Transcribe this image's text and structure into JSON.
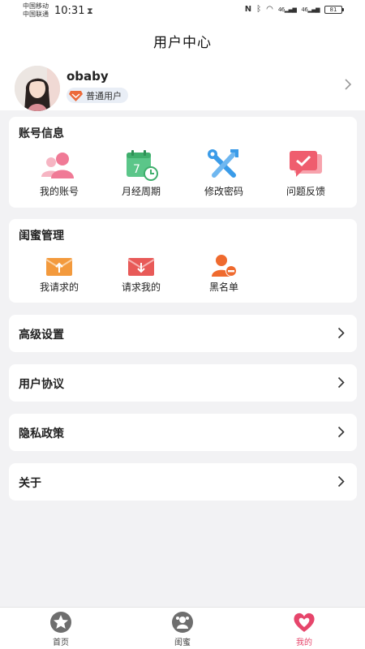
{
  "status_bar": {
    "carrier_1": "中国移动",
    "carrier_2": "中国联通",
    "time": "10:31",
    "battery": "81",
    "signal_1": "46",
    "signal_2": "46"
  },
  "header": {
    "title": "用户中心"
  },
  "profile": {
    "username": "obaby",
    "member_level": "普通用户"
  },
  "account_section": {
    "title": "账号信息",
    "items": [
      {
        "label": "我的账号",
        "icon": "user-group-icon"
      },
      {
        "label": "月经周期",
        "icon": "calendar-icon"
      },
      {
        "label": "修改密码",
        "icon": "tools-icon"
      },
      {
        "label": "问题反馈",
        "icon": "feedback-icon"
      }
    ]
  },
  "bestie_section": {
    "title": "闺蜜管理",
    "items": [
      {
        "label": "我请求的",
        "icon": "mail-upload-icon"
      },
      {
        "label": "请求我的",
        "icon": "mail-download-icon"
      },
      {
        "label": "黑名单",
        "icon": "block-user-icon"
      }
    ]
  },
  "menu_rows": [
    {
      "label": "高级设置"
    },
    {
      "label": "用户协议"
    },
    {
      "label": "隐私政策"
    },
    {
      "label": "关于"
    }
  ],
  "tabbar": {
    "tabs": [
      {
        "label": "首页",
        "icon": "star-icon"
      },
      {
        "label": "闺蜜",
        "icon": "friends-icon"
      },
      {
        "label": "我的",
        "icon": "heart-icon",
        "active": true
      }
    ]
  },
  "colors": {
    "accent_pink": "#e6456b",
    "green": "#4cc07a",
    "blue": "#3a9be8",
    "orange": "#f39a3d",
    "red": "#e85a58"
  }
}
